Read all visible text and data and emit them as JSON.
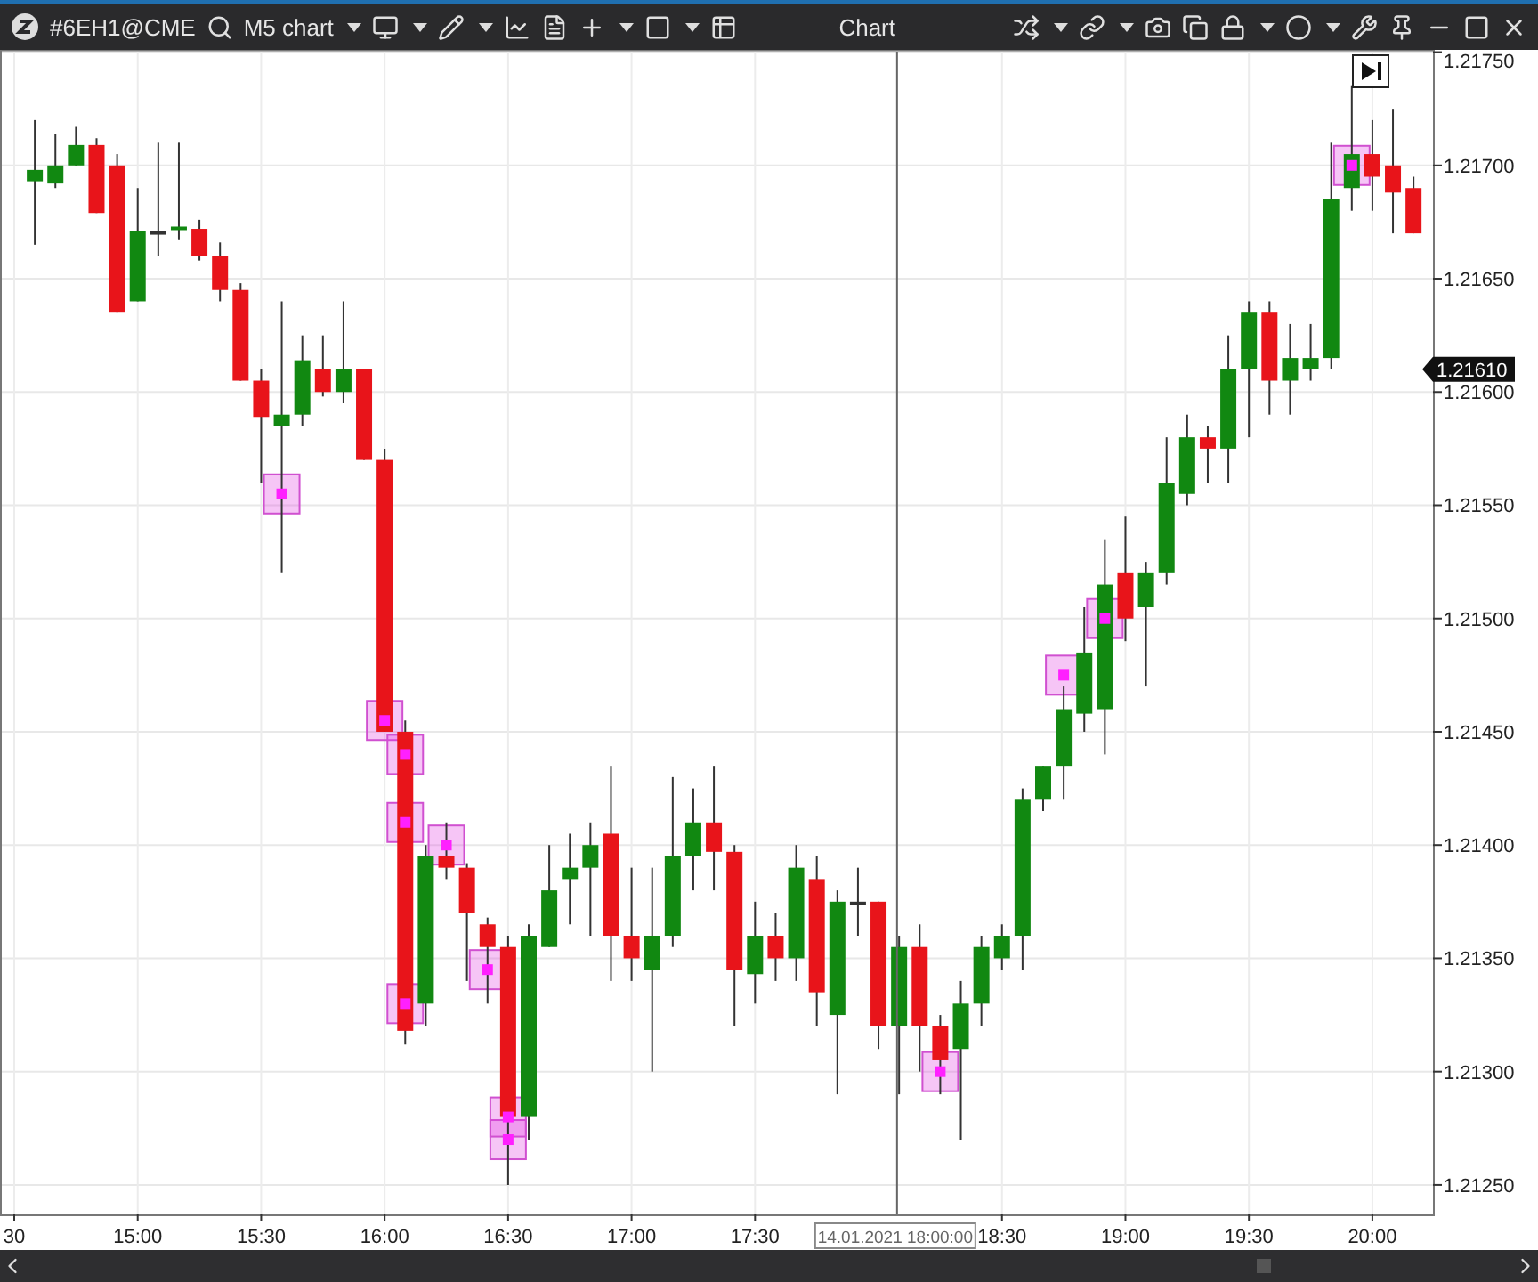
{
  "toolbar": {
    "instrument": "#6EH1@CME",
    "chart_name": "M5 chart",
    "title": "Chart"
  },
  "chart": {
    "chart_data": {
      "type": "candlestick",
      "ylim": [
        1.21237,
        1.21751
      ],
      "yticks": [
        {
          "value": 1.2125,
          "label": "1.21250"
        },
        {
          "value": 1.213,
          "label": "1.21300"
        },
        {
          "value": 1.2135,
          "label": "1.21350"
        },
        {
          "value": 1.214,
          "label": "1.21400"
        },
        {
          "value": 1.2145,
          "label": "1.21450"
        },
        {
          "value": 1.215,
          "label": "1.21500"
        },
        {
          "value": 1.2155,
          "label": "1.21550"
        },
        {
          "value": 1.216,
          "label": "1.21600"
        },
        {
          "value": 1.2165,
          "label": "1.21650"
        },
        {
          "value": 1.217,
          "label": "1.21700"
        },
        {
          "value": 1.2175,
          "label": "1.21750"
        }
      ],
      "categories": [
        "30",
        null,
        null,
        null,
        null,
        null,
        "15:00",
        null,
        null,
        null,
        null,
        null,
        "15:30",
        null,
        null,
        null,
        null,
        null,
        "16:00",
        null,
        null,
        null,
        null,
        null,
        "16:30",
        null,
        null,
        null,
        null,
        null,
        "17:00",
        null,
        null,
        null,
        null,
        null,
        "17:30",
        null,
        null,
        null,
        null,
        null,
        null,
        null,
        null,
        null,
        null,
        null,
        "18:30",
        null,
        null,
        null,
        null,
        null,
        "19:00",
        null,
        null,
        null,
        null,
        null,
        "19:30",
        null,
        null,
        null,
        null,
        null,
        "20:00",
        null,
        null
      ],
      "ohlc": [
        null,
        [
          1.21693,
          1.2172,
          1.21665,
          1.21698
        ],
        [
          1.21692,
          1.21714,
          1.2169,
          1.217
        ],
        [
          1.217,
          1.21717,
          1.217,
          1.21709
        ],
        [
          1.21709,
          1.21712,
          1.21679,
          1.21679
        ],
        [
          1.217,
          1.21705,
          1.21635,
          1.21635
        ],
        [
          1.2164,
          1.2169,
          1.2164,
          1.21671
        ],
        [
          1.21671,
          1.2171,
          1.2166,
          1.21671
        ],
        [
          1.21672,
          1.2171,
          1.21667,
          1.21673
        ],
        [
          1.21672,
          1.21676,
          1.21658,
          1.2166
        ],
        [
          1.2166,
          1.21666,
          1.2164,
          1.21645
        ],
        [
          1.21645,
          1.21648,
          1.21605,
          1.21605
        ],
        [
          1.21605,
          1.2161,
          1.2156,
          1.21589
        ],
        [
          1.21585,
          1.2164,
          1.2152,
          1.2159
        ],
        [
          1.2159,
          1.21625,
          1.21585,
          1.21614
        ],
        [
          1.2161,
          1.21625,
          1.21598,
          1.216
        ],
        [
          1.216,
          1.2164,
          1.21595,
          1.2161
        ],
        [
          1.2161,
          1.2161,
          1.2157,
          1.2157
        ],
        [
          1.2157,
          1.21575,
          1.2145,
          1.2145
        ],
        [
          1.2145,
          1.21455,
          1.21312,
          1.21318
        ],
        [
          1.2133,
          1.214,
          1.2132,
          1.21395
        ],
        [
          1.21395,
          1.2141,
          1.21385,
          1.2139
        ],
        [
          1.2139,
          1.21392,
          1.2134,
          1.2137
        ],
        [
          1.21365,
          1.21368,
          1.2133,
          1.21355
        ],
        [
          1.21355,
          1.2136,
          1.2125,
          1.2128
        ],
        [
          1.2128,
          1.21365,
          1.2127,
          1.2136
        ],
        [
          1.21355,
          1.214,
          1.21355,
          1.2138
        ],
        [
          1.21385,
          1.21405,
          1.21365,
          1.2139
        ],
        [
          1.2139,
          1.2141,
          1.2136,
          1.214
        ],
        [
          1.21405,
          1.21435,
          1.2134,
          1.2136
        ],
        [
          1.2136,
          1.2139,
          1.2134,
          1.2135
        ],
        [
          1.21345,
          1.2139,
          1.213,
          1.2136
        ],
        [
          1.2136,
          1.2143,
          1.21355,
          1.21395
        ],
        [
          1.21395,
          1.21425,
          1.2138,
          1.2141
        ],
        [
          1.2141,
          1.21435,
          1.2138,
          1.21397
        ],
        [
          1.21397,
          1.214,
          1.2132,
          1.21345
        ],
        [
          1.21343,
          1.21375,
          1.2133,
          1.2136
        ],
        [
          1.2136,
          1.2137,
          1.2134,
          1.2135
        ],
        [
          1.2135,
          1.214,
          1.2134,
          1.2139
        ],
        [
          1.21385,
          1.21395,
          1.2132,
          1.21335
        ],
        [
          1.21325,
          1.2138,
          1.2129,
          1.21375
        ],
        [
          1.21375,
          1.2139,
          1.2136,
          1.21375
        ],
        [
          1.21375,
          1.21375,
          1.2131,
          1.2132
        ],
        [
          1.2132,
          1.2136,
          1.2129,
          1.21355
        ],
        [
          1.21355,
          1.21365,
          1.213,
          1.2132
        ],
        [
          1.2132,
          1.21325,
          1.2129,
          1.21305
        ],
        [
          1.2131,
          1.2134,
          1.2127,
          1.2133
        ],
        [
          1.2133,
          1.2136,
          1.2132,
          1.21355
        ],
        [
          1.2135,
          1.21365,
          1.21345,
          1.2136
        ],
        [
          1.2136,
          1.21425,
          1.21345,
          1.2142
        ],
        [
          1.2142,
          1.21435,
          1.21415,
          1.21435
        ],
        [
          1.21435,
          1.2147,
          1.2142,
          1.2146
        ],
        [
          1.21458,
          1.21505,
          1.2145,
          1.21485
        ],
        [
          1.2146,
          1.21535,
          1.2144,
          1.21515
        ],
        [
          1.2152,
          1.21545,
          1.2149,
          1.215
        ],
        [
          1.21505,
          1.21525,
          1.2147,
          1.2152
        ],
        [
          1.2152,
          1.2158,
          1.21515,
          1.2156
        ],
        [
          1.21555,
          1.2159,
          1.2155,
          1.2158
        ],
        [
          1.2158,
          1.21585,
          1.2156,
          1.21575
        ],
        [
          1.21575,
          1.21625,
          1.2156,
          1.2161
        ],
        [
          1.2161,
          1.2164,
          1.2158,
          1.21635
        ],
        [
          1.21635,
          1.2164,
          1.2159,
          1.21605
        ],
        [
          1.21605,
          1.2163,
          1.2159,
          1.21615
        ],
        [
          1.2161,
          1.2163,
          1.21605,
          1.21615
        ],
        [
          1.21615,
          1.2171,
          1.2161,
          1.21685
        ],
        [
          1.2169,
          1.21735,
          1.2168,
          1.21705
        ],
        [
          1.21705,
          1.2172,
          1.2168,
          1.21695
        ],
        [
          1.217,
          1.21725,
          1.2167,
          1.21688
        ],
        [
          1.2169,
          1.21695,
          1.2167,
          1.2167
        ]
      ],
      "grid": true,
      "annotations": [
        "14.01.2021 18:00:00",
        "1.21610"
      ]
    }
  }
}
